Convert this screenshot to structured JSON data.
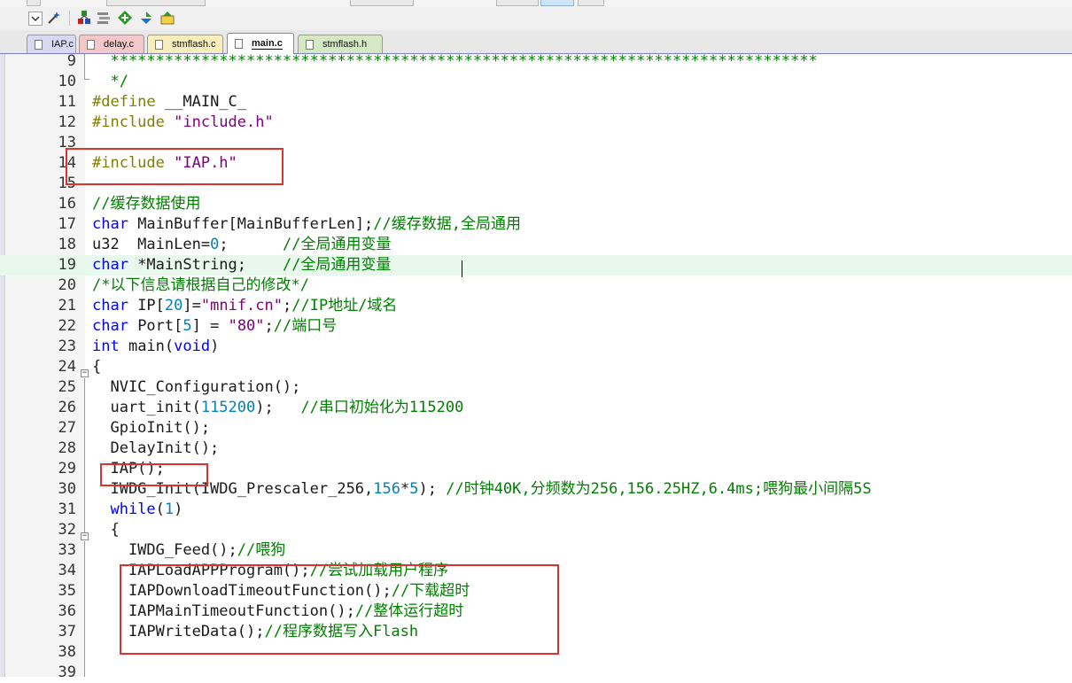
{
  "tabs": [
    {
      "label": "IAP.c",
      "color": "#d8d8f0",
      "active": false
    },
    {
      "label": "delay.c",
      "color": "#f4c8c8",
      "active": false
    },
    {
      "label": "stmflash.c",
      "color": "#f8eebc",
      "active": false
    },
    {
      "label": "main.c",
      "color": "#ffffff",
      "active": true
    },
    {
      "label": "stmflash.h",
      "color": "#d4e8c4",
      "active": false
    }
  ],
  "toolbar": {
    "icons": [
      "dropdown-icon",
      "wand-icon",
      "build-target-icon",
      "load-icon",
      "download-icon",
      "debug-icon",
      "options-icon"
    ]
  },
  "colors": {
    "keyword": "#0000ff",
    "preprocessor": "#808000",
    "string": "#800080",
    "comment": "#008000",
    "number": "#0080c0",
    "highlight": "#e8f8ec",
    "box": "#e03030"
  },
  "editor": {
    "lines": [
      {
        "n": "9",
        "tokens": [
          {
            "t": "  ******************************************************************************",
            "c": "cmt"
          }
        ]
      },
      {
        "n": "10",
        "tokens": [
          {
            "t": "  */",
            "c": "cmt"
          }
        ]
      },
      {
        "n": "11",
        "tokens": [
          {
            "t": "#define ",
            "c": "pp"
          },
          {
            "t": "__MAIN_C_",
            "c": ""
          }
        ]
      },
      {
        "n": "12",
        "tokens": [
          {
            "t": "#include ",
            "c": "pp"
          },
          {
            "t": "\"include.h\"",
            "c": "str"
          }
        ]
      },
      {
        "n": "13",
        "tokens": []
      },
      {
        "n": "14",
        "tokens": [
          {
            "t": "#include ",
            "c": "pp"
          },
          {
            "t": "\"IAP.h\"",
            "c": "str"
          }
        ]
      },
      {
        "n": "15",
        "tokens": []
      },
      {
        "n": "16",
        "tokens": [
          {
            "t": "//缓存数据使用",
            "c": "cmt"
          }
        ]
      },
      {
        "n": "17",
        "tokens": [
          {
            "t": "char",
            "c": "kw"
          },
          {
            "t": " MainBuffer[MainBufferLen];",
            "c": ""
          },
          {
            "t": "//缓存数据,全局通用",
            "c": "cmt"
          }
        ]
      },
      {
        "n": "18",
        "tokens": [
          {
            "t": "u32  MainLen=",
            "c": ""
          },
          {
            "t": "0",
            "c": "num"
          },
          {
            "t": ";      ",
            "c": ""
          },
          {
            "t": "//全局通用变量",
            "c": "cmt"
          }
        ]
      },
      {
        "n": "19",
        "tokens": [
          {
            "t": "char",
            "c": "kw"
          },
          {
            "t": " *MainString;    ",
            "c": ""
          },
          {
            "t": "//全局通用变量",
            "c": "cmt"
          }
        ]
      },
      {
        "n": "20",
        "tokens": [
          {
            "t": "/*以下信息请根据自己的修改*/",
            "c": "cmt"
          }
        ]
      },
      {
        "n": "21",
        "tokens": [
          {
            "t": "char",
            "c": "kw"
          },
          {
            "t": " IP[",
            "c": ""
          },
          {
            "t": "20",
            "c": "num"
          },
          {
            "t": "]=",
            "c": ""
          },
          {
            "t": "\"mnif.cn\"",
            "c": "str"
          },
          {
            "t": ";",
            "c": ""
          },
          {
            "t": "//IP地址/域名",
            "c": "cmt"
          }
        ]
      },
      {
        "n": "22",
        "tokens": [
          {
            "t": "char",
            "c": "kw"
          },
          {
            "t": " Port[",
            "c": ""
          },
          {
            "t": "5",
            "c": "num"
          },
          {
            "t": "] = ",
            "c": ""
          },
          {
            "t": "\"80\"",
            "c": "str"
          },
          {
            "t": ";",
            "c": ""
          },
          {
            "t": "//端口号",
            "c": "cmt"
          }
        ]
      },
      {
        "n": "23",
        "tokens": [
          {
            "t": "int",
            "c": "kw"
          },
          {
            "t": " main(",
            "c": ""
          },
          {
            "t": "void",
            "c": "kw"
          },
          {
            "t": ")",
            "c": ""
          }
        ]
      },
      {
        "n": "24",
        "tokens": [
          {
            "t": "{",
            "c": ""
          }
        ]
      },
      {
        "n": "25",
        "tokens": [
          {
            "t": "  NVIC_Configuration();",
            "c": ""
          }
        ]
      },
      {
        "n": "26",
        "tokens": [
          {
            "t": "  uart_init(",
            "c": ""
          },
          {
            "t": "115200",
            "c": "num"
          },
          {
            "t": ");   ",
            "c": ""
          },
          {
            "t": "//串口初始化为115200",
            "c": "cmt"
          }
        ]
      },
      {
        "n": "27",
        "tokens": [
          {
            "t": "  GpioInit();",
            "c": ""
          }
        ]
      },
      {
        "n": "28",
        "tokens": [
          {
            "t": "  DelayInit();",
            "c": ""
          }
        ]
      },
      {
        "n": "29",
        "tokens": [
          {
            "t": "  IAP();",
            "c": ""
          }
        ]
      },
      {
        "n": "30",
        "tokens": [
          {
            "t": "  IWDG_Init(IWDG_Prescaler_256,",
            "c": ""
          },
          {
            "t": "156",
            "c": "num"
          },
          {
            "t": "*",
            "c": ""
          },
          {
            "t": "5",
            "c": "num"
          },
          {
            "t": "); ",
            "c": ""
          },
          {
            "t": "//时钟40K,分频数为256,156.25HZ,6.4ms;喂狗最小间隔5S",
            "c": "cmt"
          }
        ]
      },
      {
        "n": "31",
        "tokens": [
          {
            "t": "  ",
            "c": ""
          },
          {
            "t": "while",
            "c": "kw"
          },
          {
            "t": "(",
            "c": ""
          },
          {
            "t": "1",
            "c": "num"
          },
          {
            "t": ")",
            "c": ""
          }
        ]
      },
      {
        "n": "32",
        "tokens": [
          {
            "t": "  {",
            "c": ""
          }
        ]
      },
      {
        "n": "33",
        "tokens": [
          {
            "t": "    IWDG_Feed();",
            "c": ""
          },
          {
            "t": "//喂狗",
            "c": "cmt"
          }
        ]
      },
      {
        "n": "34",
        "tokens": [
          {
            "t": "    IAPLoadAPPProgram();",
            "c": ""
          },
          {
            "t": "//尝试加载用户程序",
            "c": "cmt"
          }
        ]
      },
      {
        "n": "35",
        "tokens": [
          {
            "t": "    IAPDownloadTimeoutFunction();",
            "c": ""
          },
          {
            "t": "//下载超时",
            "c": "cmt"
          }
        ]
      },
      {
        "n": "36",
        "tokens": [
          {
            "t": "    IAPMainTimeoutFunction();",
            "c": ""
          },
          {
            "t": "//整体运行超时",
            "c": "cmt"
          }
        ]
      },
      {
        "n": "37",
        "tokens": [
          {
            "t": "    IAPWriteData();",
            "c": ""
          },
          {
            "t": "//程序数据写入Flash",
            "c": "cmt"
          }
        ]
      },
      {
        "n": "38",
        "tokens": []
      },
      {
        "n": "39",
        "tokens": []
      }
    ]
  }
}
